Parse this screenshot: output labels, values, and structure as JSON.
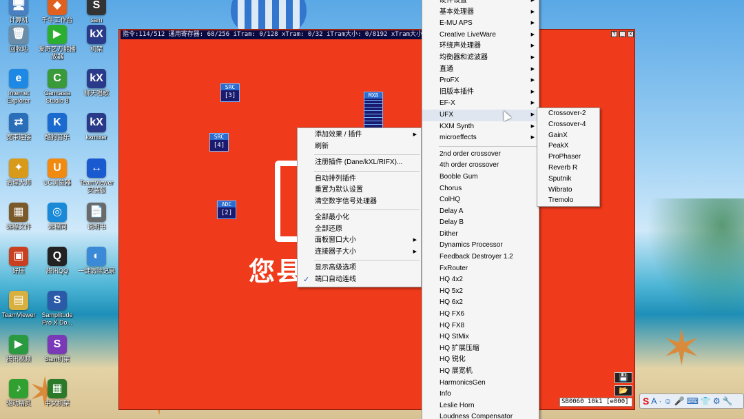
{
  "desktop": {
    "icons": [
      {
        "label": "计算机",
        "glyph": "🖥",
        "color": "#4a7fc1"
      },
      {
        "label": "回收站",
        "glyph": "🗑",
        "color": "#6b8da8"
      },
      {
        "label": "Internet Explorer",
        "glyph": "e",
        "color": "#1e88e5"
      },
      {
        "label": "宽带连接",
        "glyph": "⇄",
        "color": "#2a6db8"
      },
      {
        "label": "清理大师",
        "glyph": "✦",
        "color": "#d99a1a"
      },
      {
        "label": "远程文件",
        "glyph": "▦",
        "color": "#7a5a2a"
      },
      {
        "label": "好压",
        "glyph": "▣",
        "color": "#c84020"
      },
      {
        "label": "TeamViewer",
        "glyph": "▤",
        "color": "#d8b040"
      },
      {
        "label": "腾讯视频",
        "glyph": "▶",
        "color": "#2a9a40"
      },
      {
        "label": "驱动精灵",
        "glyph": "♪",
        "color": "#30a030"
      },
      {
        "label": "千牛工作台",
        "glyph": "◆",
        "color": "#e06020"
      },
      {
        "label": "爱奇艺万能播放器",
        "glyph": "▶",
        "color": "#2cae30"
      },
      {
        "label": "Camtasia Studio 8",
        "glyph": "C",
        "color": "#3a9a3a"
      },
      {
        "label": "酷狗音乐",
        "glyph": "K",
        "color": "#1a6ad0"
      },
      {
        "label": "UC浏览器",
        "glyph": "U",
        "color": "#f08a10"
      },
      {
        "label": "远程同",
        "glyph": "◎",
        "color": "#1a8ad8"
      },
      {
        "label": "腾讯QQ",
        "glyph": "Q",
        "color": "#222"
      },
      {
        "label": "Samplitude Pro X Do...",
        "glyph": "S",
        "color": "#2a5aa8"
      },
      {
        "label": "Sam机架",
        "glyph": "S",
        "color": "#7a3ab8"
      },
      {
        "label": "中文机架",
        "glyph": "▦",
        "color": "#2a7a2a"
      },
      {
        "label": "sam",
        "glyph": "S",
        "color": "#333"
      },
      {
        "label": "机架",
        "glyph": "kX",
        "color": "#2a3a8a"
      },
      {
        "label": "聊天唱歌",
        "glyph": "kX",
        "color": "#2a3a8a"
      },
      {
        "label": "kxmixer",
        "glyph": "kX",
        "color": "#2a3a8a"
      },
      {
        "label": "TeamViewer 安装版",
        "glyph": "↔",
        "color": "#1a5ad0"
      },
      {
        "label": "说明书",
        "glyph": "📄",
        "color": "#6a6a6a"
      },
      {
        "label": "一键清除记录",
        "glyph": "◐",
        "color": "#3a8ad8"
      }
    ]
  },
  "kx_window": {
    "title": "指令:114/512 通用寄存器: 68/256 iTram: 0/128 xTram: 0/32 iTram大小: 0/8192 xTram大小: 0/256",
    "buttons": {
      "help": "?",
      "minimize": "_",
      "close": "x"
    },
    "blocks": [
      {
        "header": "SRC",
        "num": "[3]"
      },
      {
        "header": "SRC",
        "num": "[4]"
      },
      {
        "header": "ADC",
        "num": "[2]"
      },
      {
        "header": "MX8",
        "num": ""
      }
    ],
    "big_text": "您县",
    "status_text": "SB0060 10k1 [e000]",
    "tool_save": "💾",
    "tool_open": "📂"
  },
  "context_menu": {
    "items": [
      {
        "label": "添加效果 / 插件",
        "arrow": true
      },
      {
        "label": "刷新"
      },
      {
        "sep": true
      },
      {
        "label": "注册插件 (Dane/kXL/RIFX)..."
      },
      {
        "sep": true
      },
      {
        "label": "自动排列插件"
      },
      {
        "label": "重置为默认设置"
      },
      {
        "label": "清空数字信号处理器"
      },
      {
        "sep": true
      },
      {
        "label": "全部最小化"
      },
      {
        "label": "全部还原"
      },
      {
        "label": "面板窗口大小",
        "arrow": true
      },
      {
        "label": "连接器子大小",
        "arrow": true
      },
      {
        "sep": true
      },
      {
        "label": "显示高级选项"
      },
      {
        "label": "端口自动连线",
        "check": true
      }
    ]
  },
  "plugin_menu": {
    "items": [
      {
        "label": "硬件设置",
        "arrow": true
      },
      {
        "label": "基本处理器",
        "arrow": true
      },
      {
        "label": "E-MU APS",
        "arrow": true
      },
      {
        "label": "Creative LiveWare",
        "arrow": true
      },
      {
        "label": "环绕声处理器",
        "arrow": true
      },
      {
        "label": "均衡器和滤波器",
        "arrow": true
      },
      {
        "label": "直通",
        "arrow": true
      },
      {
        "label": "ProFX",
        "arrow": true
      },
      {
        "label": "旧版本插件",
        "arrow": true
      },
      {
        "label": "EF-X",
        "arrow": true
      },
      {
        "label": "UFX",
        "arrow": true,
        "hl": true
      },
      {
        "label": "KXM Synth",
        "arrow": true
      },
      {
        "label": "microeffects",
        "arrow": true
      },
      {
        "sep": true
      },
      {
        "label": "2nd order crossover"
      },
      {
        "label": "4th order crossover"
      },
      {
        "label": "Booble Gum"
      },
      {
        "label": "Chorus"
      },
      {
        "label": "ColHQ"
      },
      {
        "label": "Delay A"
      },
      {
        "label": "Delay B"
      },
      {
        "label": "Dither"
      },
      {
        "label": "Dynamics Processor"
      },
      {
        "label": "Feedback Destroyer 1.2"
      },
      {
        "label": "FxRouter"
      },
      {
        "label": "HQ 4x2"
      },
      {
        "label": "HQ 5x2"
      },
      {
        "label": "HQ 6x2"
      },
      {
        "label": "HQ FX6"
      },
      {
        "label": "HQ FX8"
      },
      {
        "label": "HQ StMix"
      },
      {
        "label": "HQ 扩展压缩"
      },
      {
        "label": "HQ 锐化"
      },
      {
        "label": "HQ 展宽机"
      },
      {
        "label": "HarmonicsGen"
      },
      {
        "label": "Info"
      },
      {
        "label": "Leslie Horn"
      },
      {
        "label": "Loudness Compensator"
      }
    ]
  },
  "ufx_menu": {
    "items": [
      "Crossover-2",
      "Crossover-4",
      "GainX",
      "PeakX",
      "ProPhaser",
      "Reverb R",
      "Sputnik",
      "Wibrato",
      "Tremolo"
    ]
  },
  "tray": {
    "logo": "S",
    "items": [
      "A",
      "·",
      "☺",
      "🎤",
      "⌨",
      "👕",
      "⚙",
      "🔧"
    ]
  }
}
